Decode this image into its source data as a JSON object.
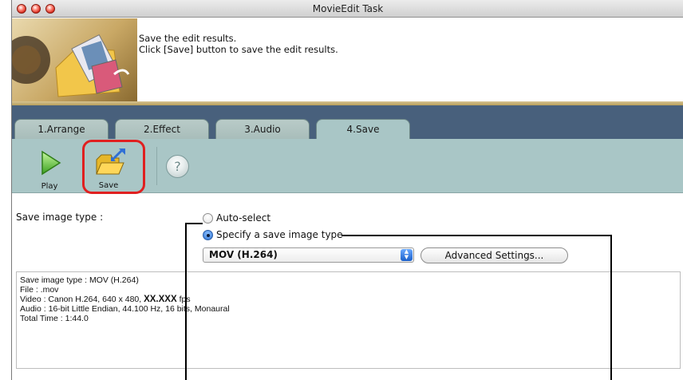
{
  "window": {
    "title": "MovieEdit Task"
  },
  "header": {
    "line1": "Save the edit results.",
    "line2": "Click [Save] button to save the edit results."
  },
  "tabs": [
    {
      "label": "1.Arrange",
      "active": false
    },
    {
      "label": "2.Effect",
      "active": false
    },
    {
      "label": "3.Audio",
      "active": false
    },
    {
      "label": "4.Save",
      "active": true
    }
  ],
  "toolbar": {
    "play_label": "Play",
    "save_label": "Save",
    "help_glyph": "?"
  },
  "save": {
    "type_label": "Save image type :",
    "auto_select_label": "Auto-select",
    "specify_label": "Specify a save image type",
    "selected_option": "MOV (H.264)",
    "selected_radio": "specify",
    "advanced_button": "Advanced Settings..."
  },
  "info": {
    "line1": "Save image type : MOV (H.264)",
    "line2": "File : .mov",
    "line3_prefix": "Video : Canon H.264, 640 x 480, ",
    "line3_xx": "XX.XXX",
    "line3_suffix": " fps",
    "line4_a": "Audio : 16-bit Little Endian, 44.100 ",
    "line4_b": "Hz, 16 bits, Monaural",
    "line5": "Total Time : 1:44.0"
  },
  "colors": {
    "tab_area": "#48607c",
    "toolbar": "#a9c6c6",
    "highlight": "#e02020",
    "header_band": "#c8b171"
  },
  "icons": [
    "play-icon",
    "save-folder-icon",
    "help-icon",
    "header-art-icon"
  ]
}
